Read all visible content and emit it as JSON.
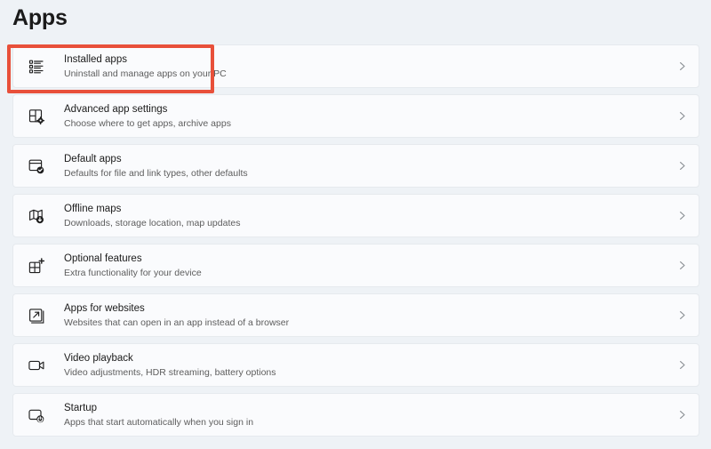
{
  "header": {
    "title": "Apps"
  },
  "highlight": {
    "color": "#e8503a",
    "target": "Installed apps"
  },
  "colors": {
    "background": "#eef2f6",
    "card_background": "#fafbfd",
    "card_border": "#e6eaee",
    "title_text": "#1b1b1b",
    "subtitle_text": "#5d5d5d",
    "chevron": "#8a8f94",
    "highlight_accent": "#e8503a"
  },
  "settings_list": [
    {
      "icon": "installed-apps-list-icon",
      "title": "Installed apps",
      "subtitle": "Uninstall and manage apps on your PC",
      "chevron": "chevron-right-icon",
      "highlighted": true
    },
    {
      "icon": "advanced-app-settings-grid-gear-icon",
      "title": "Advanced app settings",
      "subtitle": "Choose where to get apps, archive apps",
      "chevron": "chevron-right-icon",
      "highlighted": false
    },
    {
      "icon": "default-apps-window-check-icon",
      "title": "Default apps",
      "subtitle": "Defaults for file and link types, other defaults",
      "chevron": "chevron-right-icon",
      "highlighted": false
    },
    {
      "icon": "offline-maps-map-download-icon",
      "title": "Offline maps",
      "subtitle": "Downloads, storage location, map updates",
      "chevron": "chevron-right-icon",
      "highlighted": false
    },
    {
      "icon": "optional-features-grid-plus-icon",
      "title": "Optional features",
      "subtitle": "Extra functionality for your device",
      "chevron": "chevron-right-icon",
      "highlighted": false
    },
    {
      "icon": "apps-for-websites-external-link-icon",
      "title": "Apps for websites",
      "subtitle": "Websites that can open in an app instead of a browser",
      "chevron": "chevron-right-icon",
      "highlighted": false
    },
    {
      "icon": "video-playback-video-camera-icon",
      "title": "Video playback",
      "subtitle": "Video adjustments, HDR streaming, battery options",
      "chevron": "chevron-right-icon",
      "highlighted": false
    },
    {
      "icon": "startup-window-power-icon",
      "title": "Startup",
      "subtitle": "Apps that start automatically when you sign in",
      "chevron": "chevron-right-icon",
      "highlighted": false
    }
  ]
}
